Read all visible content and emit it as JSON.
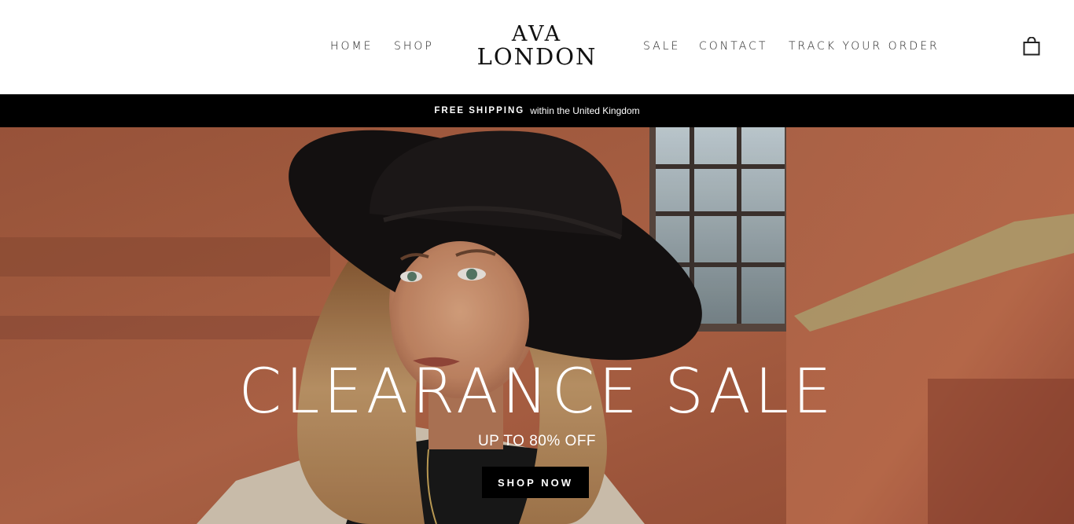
{
  "header": {
    "nav_left": [
      {
        "label": "HOME"
      },
      {
        "label": "SHOP"
      }
    ],
    "logo": {
      "line1": "AVA",
      "line2": "LONDON"
    },
    "nav_right": [
      {
        "label": "SALE"
      },
      {
        "label": "CONTACT"
      },
      {
        "label": "TRACK YOUR ORDER"
      }
    ],
    "cart_icon": "shopping-bag-icon"
  },
  "announcement": {
    "strong": "FREE SHIPPING",
    "text": "within the United Kingdom"
  },
  "hero": {
    "title": "CLEARANCE SALE",
    "subtitle": "UP TO 80% OFF",
    "button_label": "SHOP NOW"
  },
  "colors": {
    "announcement_bg": "#000000",
    "button_bg": "#000000",
    "text_light": "#ffffff",
    "hero_brick": "#b5623f"
  }
}
